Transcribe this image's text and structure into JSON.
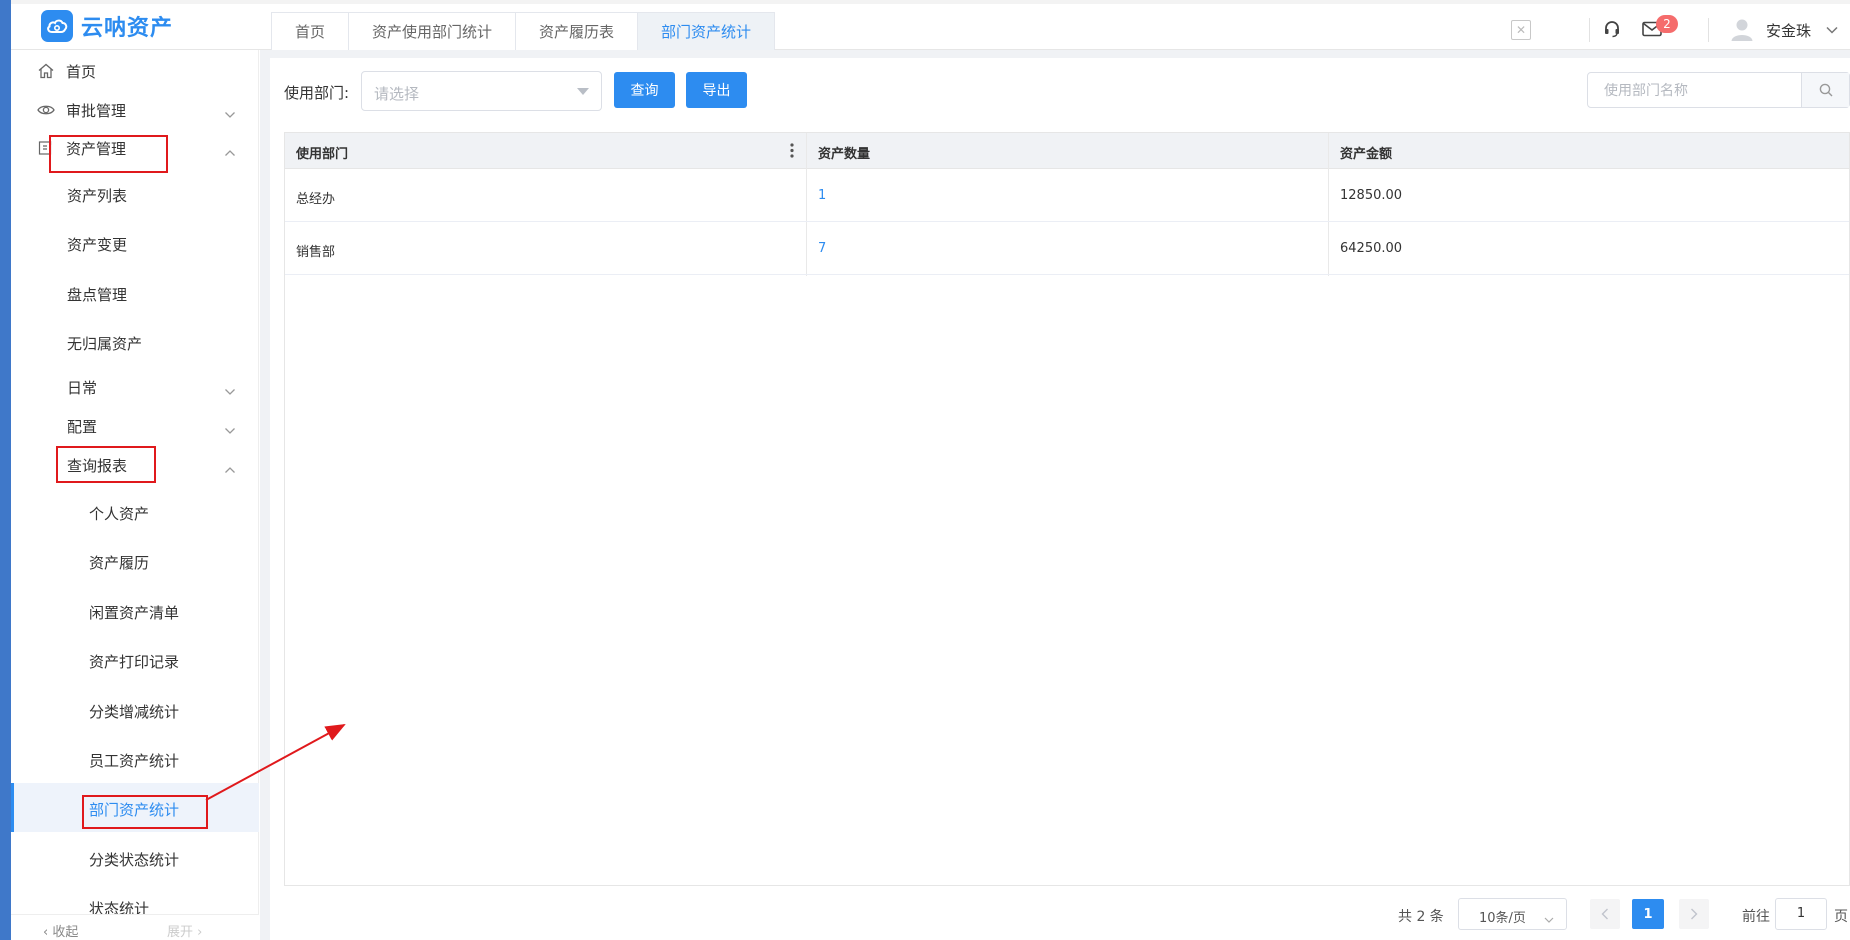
{
  "app": {
    "logo_text": "云呐资产",
    "brand_color": "#2d8cf0"
  },
  "tabs": [
    {
      "label": "首页"
    },
    {
      "label": "资产使用部门统计"
    },
    {
      "label": "资产履历表"
    },
    {
      "label": "部门资产统计",
      "active": true
    }
  ],
  "header": {
    "notification_count": "2",
    "user_name": "安金珠",
    "icons": [
      "close-icon",
      "headset-icon",
      "mail-icon",
      "user-avatar-icon",
      "chevron-down-icon"
    ]
  },
  "sidebar": {
    "items": [
      {
        "label": "首页",
        "icon": "home-icon"
      },
      {
        "label": "审批管理",
        "icon": "eye-icon"
      },
      {
        "label": "资产管理",
        "icon": "asset-icon"
      },
      {
        "label": "资产列表"
      },
      {
        "label": "资产变更"
      },
      {
        "label": "盘点管理"
      },
      {
        "label": "无归属资产"
      },
      {
        "label": "日常"
      },
      {
        "label": "配置"
      },
      {
        "label": "查询报表"
      },
      {
        "label": "个人资产"
      },
      {
        "label": "资产履历"
      },
      {
        "label": "闲置资产清单"
      },
      {
        "label": "资产打印记录"
      },
      {
        "label": "分类增减统计"
      },
      {
        "label": "员工资产统计"
      },
      {
        "label": "部门资产统计",
        "active": true
      },
      {
        "label": "分类状态统计"
      },
      {
        "label": "状态统计"
      }
    ],
    "footer": {
      "collapse": "‹ 收起",
      "expand": "展开 ›"
    }
  },
  "filter": {
    "label": "使用部门:",
    "select_placeholder": "请选择",
    "query_button": "查询",
    "export_button": "导出",
    "search_placeholder": "使用部门名称"
  },
  "table": {
    "columns": [
      "使用部门",
      "资产数量",
      "资产金额"
    ],
    "rows": [
      [
        "总经办",
        "1",
        "12850.00"
      ],
      [
        "销售部",
        "7",
        "64250.00"
      ]
    ]
  },
  "pagination": {
    "total": "共 2 条",
    "page_size": "10条/页",
    "current_page": "1",
    "goto_label": "前往",
    "goto_value": "1",
    "page_suffix": "页"
  },
  "annotation_color": "#e0191c"
}
